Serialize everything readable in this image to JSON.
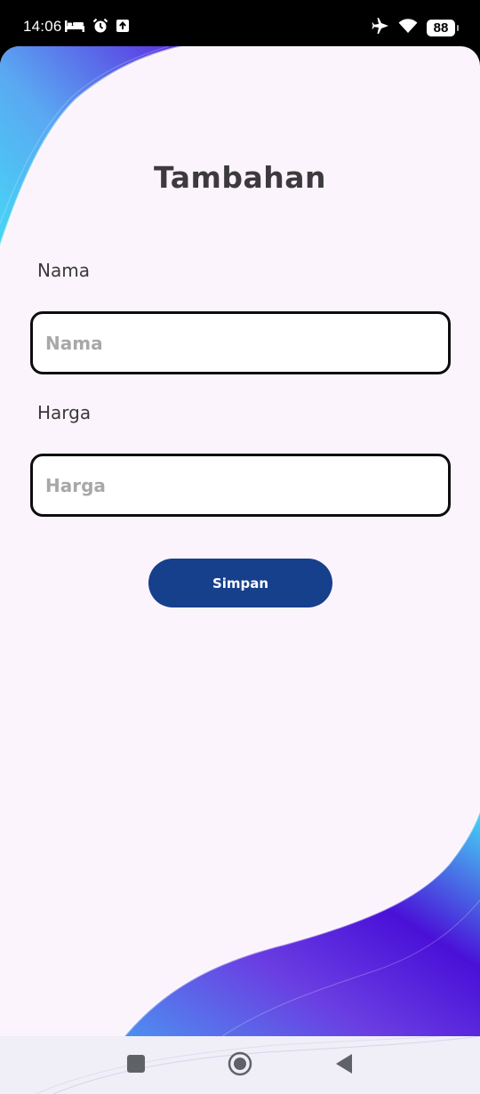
{
  "status_bar": {
    "time": "14:06",
    "battery": "88",
    "left_icons": [
      "bed-icon",
      "alarm-icon",
      "upload-icon"
    ],
    "right_icons": [
      "airplane-icon",
      "wifi-icon",
      "battery-icon"
    ]
  },
  "page": {
    "title": "Tambahan"
  },
  "form": {
    "nama": {
      "label": "Nama",
      "placeholder": "Nama",
      "value": ""
    },
    "harga": {
      "label": "Harga",
      "placeholder": "Harga",
      "value": ""
    },
    "save_label": "Simpan"
  },
  "nav_bar": {
    "icons": [
      "recent-apps-icon",
      "home-icon",
      "back-icon"
    ]
  },
  "colors": {
    "background": "#fcf4fc",
    "button": "#163f8c",
    "title": "#3d3a3e",
    "wave_purple": "#4a10d8",
    "wave_cyan": "#46d6f5"
  }
}
